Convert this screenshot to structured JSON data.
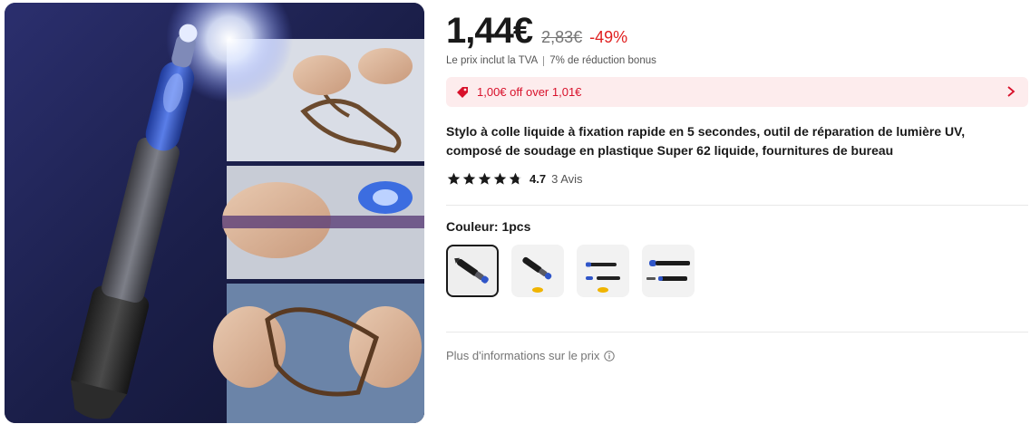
{
  "price": {
    "current": "1,44€",
    "original": "2,83€",
    "discount": "-49%",
    "tax_note": "Le prix inclut la TVA",
    "bonus_note": "7% de réduction bonus"
  },
  "coupon": {
    "text": "1,00€ off over 1,01€"
  },
  "product": {
    "title": "Stylo à colle liquide à fixation rapide en 5 secondes, outil de réparation de lumière UV, composé de soudage en plastique Super 62 liquide, fournitures de bureau"
  },
  "rating": {
    "stars": 4.7,
    "value": "4.7",
    "reviews": "3 Avis"
  },
  "variant": {
    "label": "Couleur:",
    "selected": "1pcs",
    "options_count": 4
  },
  "more_info": {
    "text": "Plus d'informations sur le prix"
  },
  "colors": {
    "accent_red": "#e02020",
    "coupon_bg": "#fdeced",
    "pen_blue": "#3a5cc8"
  },
  "icons": [
    "coupon-tag-icon",
    "chevron-right-icon",
    "star-icon",
    "info-icon"
  ]
}
